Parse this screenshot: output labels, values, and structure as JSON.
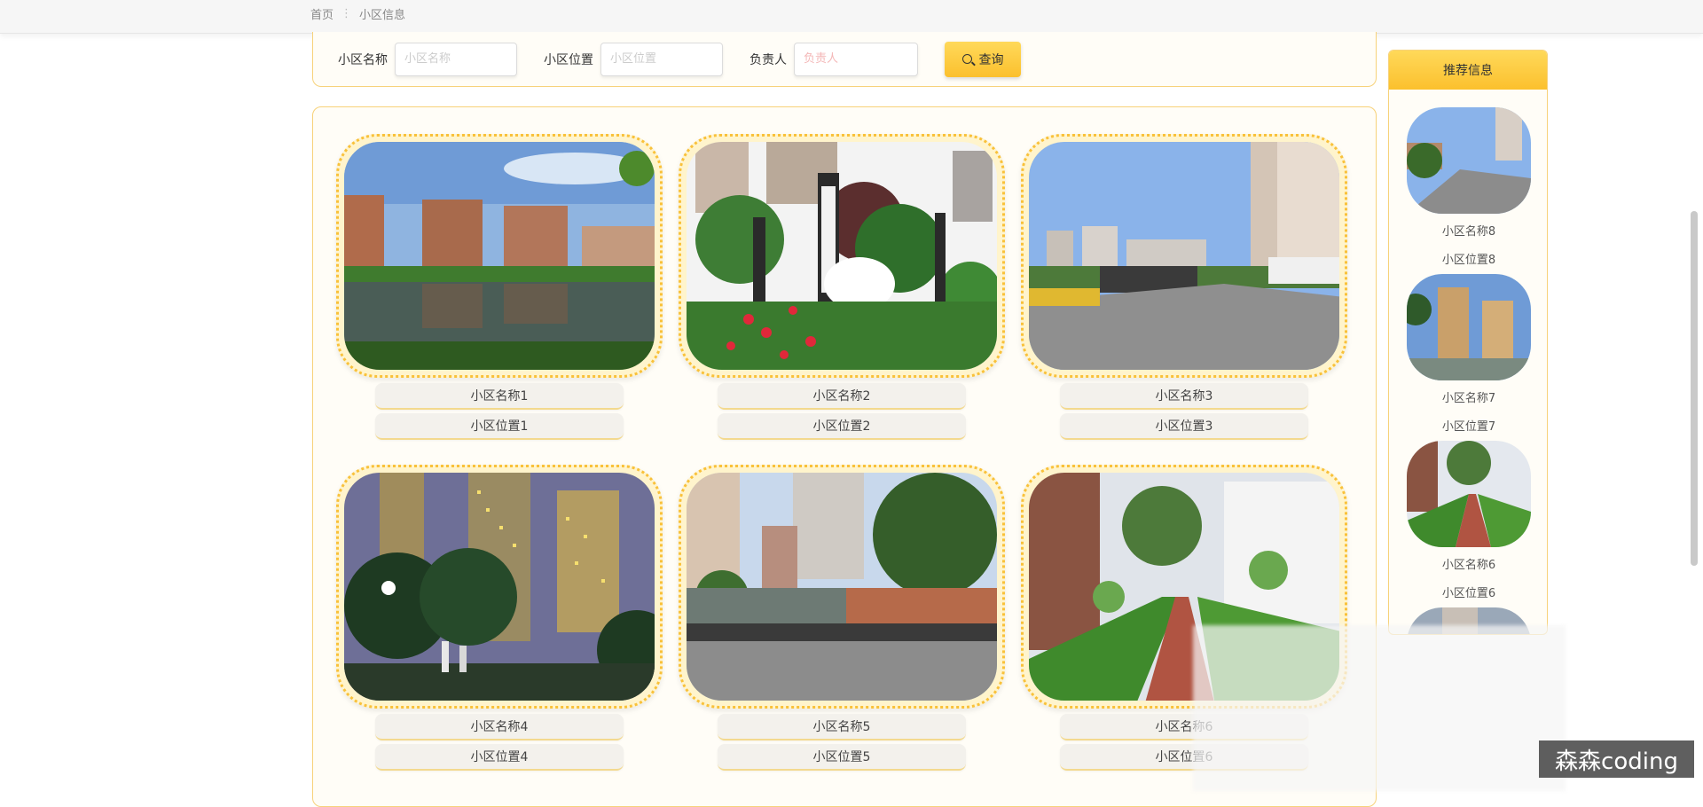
{
  "breadcrumb": {
    "home": "首页",
    "separator": "⋮",
    "current": "小区信息"
  },
  "search": {
    "name_label": "小区名称",
    "name_placeholder": "小区名称",
    "location_label": "小区位置",
    "location_placeholder": "小区位置",
    "manager_label": "负责人",
    "manager_placeholder": "负责人",
    "query_label": "查询"
  },
  "cards": [
    {
      "name": "小区名称1",
      "location": "小区位置1"
    },
    {
      "name": "小区名称2",
      "location": "小区位置2"
    },
    {
      "name": "小区名称3",
      "location": "小区位置3"
    },
    {
      "name": "小区名称4",
      "location": "小区位置4"
    },
    {
      "name": "小区名称5",
      "location": "小区位置5"
    },
    {
      "name": "小区名称6",
      "location": "小区位置6"
    }
  ],
  "sidebar": {
    "title": "推荐信息",
    "items": [
      {
        "name": "小区名称8",
        "location": "小区位置8"
      },
      {
        "name": "小区名称7",
        "location": "小区位置7"
      },
      {
        "name": "小区名称6",
        "location": "小区位置6"
      }
    ]
  },
  "watermark": "森森coding",
  "colors": {
    "accent": "#fbc02d",
    "border": "#f7d27a"
  }
}
